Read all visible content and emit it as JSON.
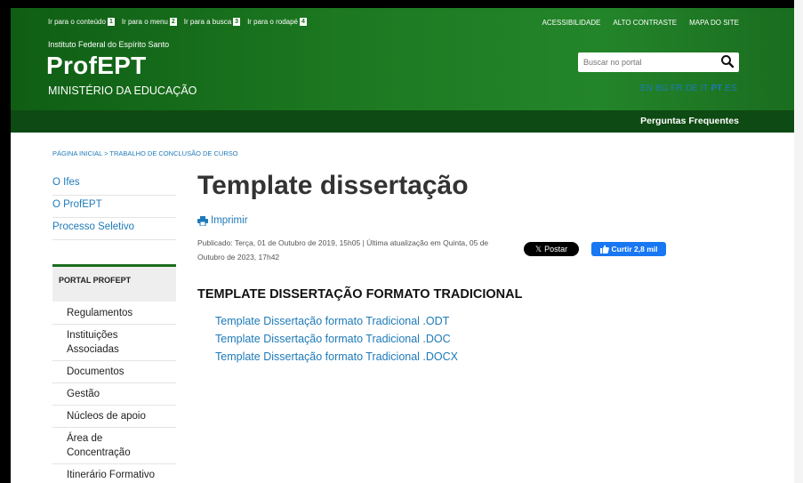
{
  "accessibility_links": [
    {
      "label": "Ir para o conteúdo",
      "key": "1"
    },
    {
      "label": "Ir para o menu",
      "key": "2"
    },
    {
      "label": "Ir para a busca",
      "key": "3"
    },
    {
      "label": "Ir para o rodapé",
      "key": "4"
    }
  ],
  "top_links": [
    "ACESSIBILIDADE",
    "ALTO CONTRASTE",
    "MAPA DO SITE"
  ],
  "header": {
    "institution": "Instituto Federal do Espírito Santo",
    "logo": "ProfEPT",
    "ministry": "MINISTÉRIO DA EDUCAÇÃO"
  },
  "search": {
    "placeholder": "Buscar no portal",
    "icon": "search-icon"
  },
  "languages": [
    "EN",
    "BG",
    "FR",
    "DE",
    "IT",
    "PT",
    "ES"
  ],
  "active_language": "PT",
  "navbar": {
    "faq": "Perguntas Frequentes"
  },
  "breadcrumb": "PÁGINA INICIAL > TRABALHO DE CONCLUSÃO DE CURSO",
  "sidebar": {
    "links": [
      "O Ifes",
      "O ProfEPT",
      "Processo Seletivo"
    ],
    "portal_title": "PORTAL PROFEPT",
    "menu": [
      "Regulamentos",
      "Instituições Associadas",
      "Documentos",
      "Gestão",
      "Núcleos de apoio",
      "Área de Concentração",
      "Itinerário Formativo"
    ]
  },
  "content": {
    "title": "Template dissertação",
    "print": "Imprimir",
    "published": "Publicado: Terça, 01 de Outubro de 2019, 15h05 | Última atualização em Quinta, 05 de Outubro de 2023, 17h42",
    "x_button": "Postar",
    "fb_button": "Curtir 2,8 mil",
    "section_title": "TEMPLATE DISSERTAÇÃO FORMATO TRADICIONAL",
    "docs": [
      "Template Dissertação formato Tradicional .ODT",
      "Template Dissertação formato Tradicional .DOC",
      "Template Dissertação formato Tradicional .DOCX"
    ]
  },
  "colors": {
    "header_green": "#1d7a22",
    "nav_dark": "#0e4a13",
    "link_blue": "#1e7ab8"
  }
}
